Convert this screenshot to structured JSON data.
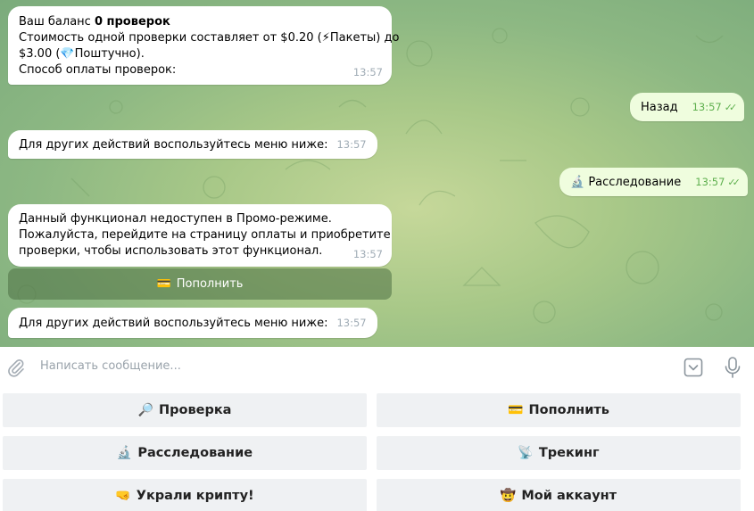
{
  "messages": {
    "balance": {
      "prefix": "Ваш баланс ",
      "count": "0 проверок",
      "line2_a": "Стоимость одной проверки составляет от $0.20 (",
      "line2_emoji": "⚡",
      "line2_b": "Пакеты) до",
      "line3_a": "$3.00 (",
      "line3_emoji": "💎",
      "line3_b": "Поштучно).",
      "line4": "Способ оплаты проверок:",
      "time": "13:57"
    },
    "back": {
      "text": "Назад",
      "time": "13:57",
      "ticks": "✓✓"
    },
    "other1": {
      "text": "Для других действий воспользуйтесь меню ниже:",
      "time": "13:57"
    },
    "investigation": {
      "emoji": "🔬",
      "text": "Расследование",
      "time": "13:57",
      "ticks": "✓✓"
    },
    "promo": {
      "line1": "Данный функционал недоступен в Промо-режиме.",
      "line2": "Пожалуйста, перейдите на страницу оплаты и приобретите",
      "line3": "проверки, чтобы использовать этот функционал.",
      "time": "13:57"
    },
    "inline_button": {
      "emoji": "💳",
      "label": "Пополнить"
    },
    "other2": {
      "text": "Для других действий воспользуйтесь меню ниже:",
      "time": "13:57"
    }
  },
  "composer": {
    "placeholder": "Написать сообщение..."
  },
  "keyboard": [
    {
      "emoji": "🔎",
      "label": "Проверка"
    },
    {
      "emoji": "💳",
      "label": "Пополнить"
    },
    {
      "emoji": "🔬",
      "label": "Расследование"
    },
    {
      "emoji": "📡",
      "label": "Трекинг"
    },
    {
      "emoji": "🤜",
      "label": "Украли крипту!"
    },
    {
      "emoji": "🤠",
      "label": "Мой аккаунт"
    }
  ],
  "colors": {
    "chat_bg": "#9cc285",
    "outgoing_bubble": "#effdde",
    "tick_green": "#5fb04f",
    "keyboard_button": "#eff1f3"
  },
  "icons": {
    "attach": "paperclip-icon",
    "keyboard": "keyboard-toggle-icon",
    "mic": "microphone-icon"
  }
}
